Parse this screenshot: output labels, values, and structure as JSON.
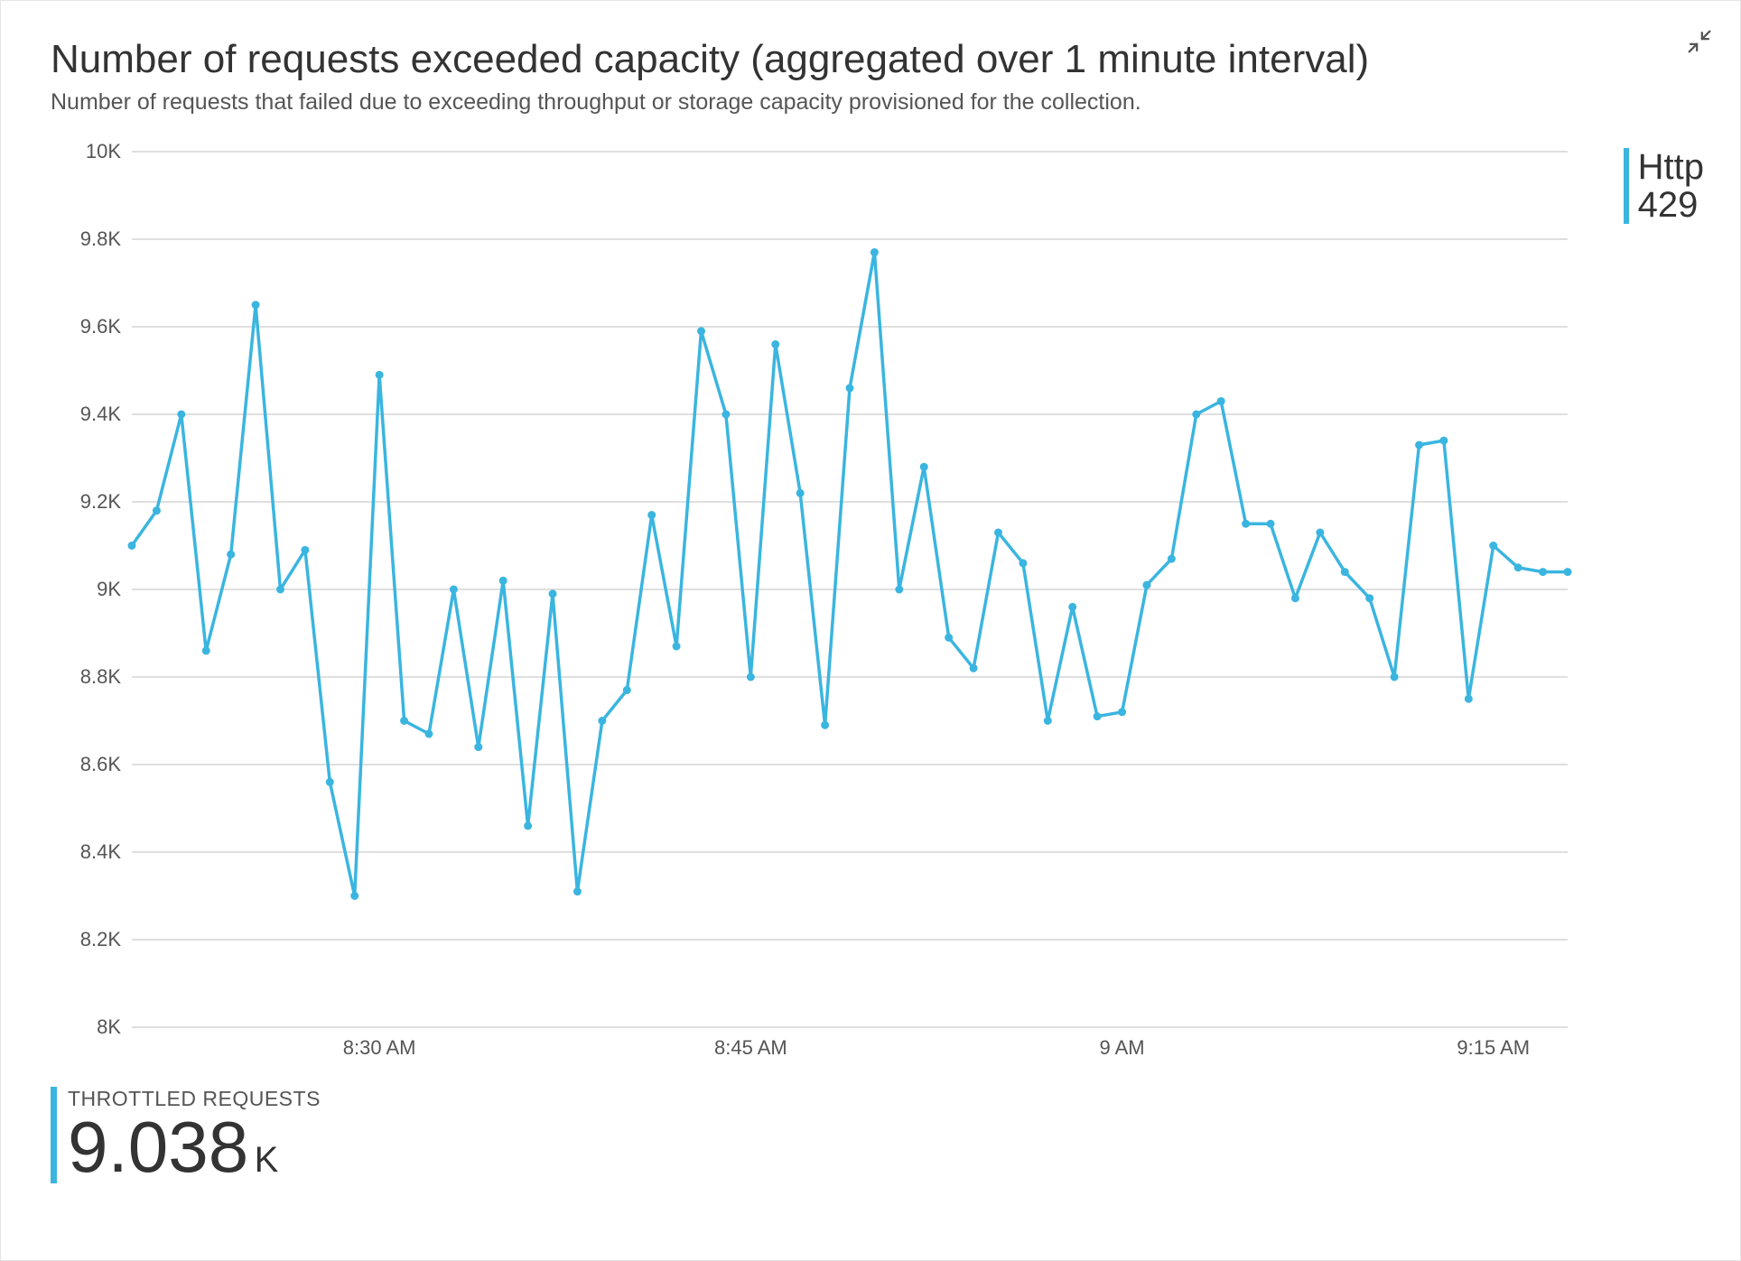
{
  "header": {
    "title": "Number of requests exceeded capacity (aggregated over 1 minute interval)",
    "subtitle": "Number of requests that failed due to exceeding throughput or storage capacity provisioned for the collection."
  },
  "legend": {
    "entry": {
      "line1": "Http",
      "line2": "429",
      "color": "#3ab5e0"
    }
  },
  "stat": {
    "label": "THROTTLED REQUESTS",
    "value": "9.038",
    "unit": "K"
  },
  "chart_data": {
    "type": "line",
    "title": "Number of requests exceeded capacity",
    "xlabel": "",
    "ylabel": "",
    "ylim": [
      8000,
      10000
    ],
    "y_ticks": [
      8000,
      8200,
      8400,
      8600,
      8800,
      9000,
      9200,
      9400,
      9600,
      9800,
      10000
    ],
    "y_tick_labels": [
      "8K",
      "8.2K",
      "8.4K",
      "8.6K",
      "8.8K",
      "9K",
      "9.2K",
      "9.4K",
      "9.6K",
      "9.8K",
      "10K"
    ],
    "x_ticks_at_minutes": [
      510,
      525,
      540,
      555
    ],
    "x_tick_labels": [
      "8:30 AM",
      "8:45 AM",
      "9 AM",
      "9:15 AM"
    ],
    "series": [
      {
        "name": "Http 429",
        "color": "#3ab5e0",
        "x_minutes": [
          500,
          501,
          502,
          503,
          504,
          505,
          506,
          507,
          508,
          509,
          510,
          511,
          512,
          513,
          514,
          515,
          516,
          517,
          518,
          519,
          520,
          521,
          522,
          523,
          524,
          525,
          526,
          527,
          528,
          529,
          530,
          531,
          532,
          533,
          534,
          535,
          536,
          537,
          538,
          539,
          540,
          541,
          542,
          543,
          544,
          545,
          546,
          547,
          548,
          549,
          550,
          551,
          552,
          553,
          554,
          555,
          556,
          557,
          558
        ],
        "values": [
          9100,
          9180,
          9400,
          8860,
          9080,
          9650,
          9000,
          9090,
          8560,
          8300,
          9490,
          8700,
          8670,
          9000,
          8640,
          9020,
          8460,
          8990,
          8310,
          8700,
          8770,
          9170,
          8870,
          9590,
          9400,
          8800,
          9560,
          9220,
          8690,
          9460,
          9770,
          9000,
          9280,
          8890,
          8820,
          9130,
          9060,
          8700,
          8960,
          8710,
          8720,
          9010,
          9070,
          9400,
          9430,
          9150,
          9150,
          8980,
          9130,
          9040,
          8980,
          8800,
          9330,
          9340,
          8750,
          9100,
          9050,
          9040,
          9040
        ]
      }
    ]
  }
}
